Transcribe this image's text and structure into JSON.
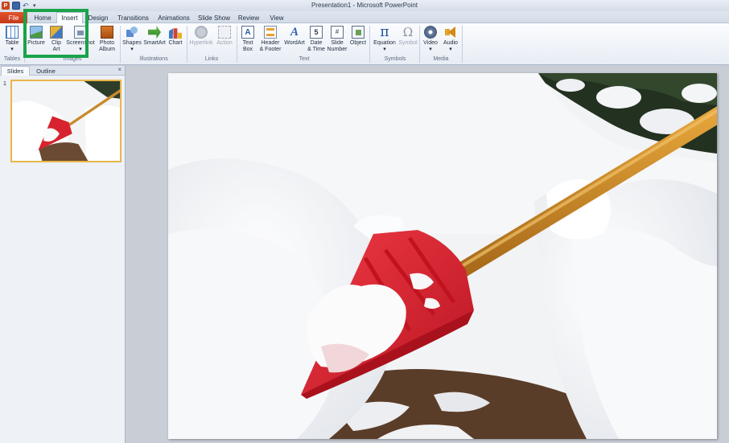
{
  "app": {
    "window_title": "Presentation1 - Microsoft PowerPoint",
    "logo_letter": "P"
  },
  "tabs": {
    "file": "File",
    "items": [
      "Home",
      "Insert",
      "Design",
      "Transitions",
      "Animations",
      "Slide Show",
      "Review",
      "View"
    ],
    "active": "Insert"
  },
  "ribbon": {
    "groups": {
      "tables": "Tables",
      "images": "Images",
      "illustrations": "Illustrations",
      "links": "Links",
      "text": "Text",
      "symbols": "Symbols",
      "media": "Media"
    },
    "buttons": {
      "table": "Table",
      "picture": "Picture",
      "clip_art": "Clip\nArt",
      "screenshot": "Screenshot",
      "photo_album": "Photo\nAlbum",
      "shapes": "Shapes",
      "smartart": "SmartArt",
      "chart": "Chart",
      "hyperlink": "Hyperlink",
      "action": "Action",
      "text_box": "Text\nBox",
      "header_footer": "Header\n& Footer",
      "wordart": "WordArt",
      "date_time": "Date\n& Time",
      "slide_number": "Slide\nNumber",
      "object": "Object",
      "equation": "Equation",
      "symbol": "Symbol",
      "video": "Video",
      "audio": "Audio"
    },
    "icon_glyphs": {
      "text_box": "A",
      "wordart": "A",
      "date_time": "5",
      "slide_number": "#",
      "equation": "π",
      "symbol": "Ω"
    }
  },
  "highlight_color": "#1aa34a",
  "left_panel": {
    "tabs": [
      "Slides",
      "Outline"
    ],
    "close": "×",
    "slide_number": "1"
  },
  "slide": {
    "image": "snow-shovel-photo"
  }
}
